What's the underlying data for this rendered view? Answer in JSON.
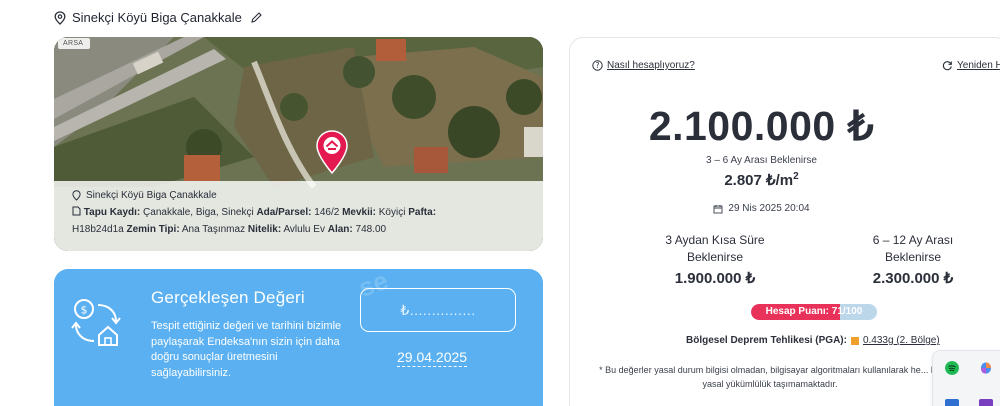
{
  "header": {
    "location": "Sinekçi Köyü Biga Çanakkale"
  },
  "map": {
    "tag": "ARSA",
    "info": {
      "location": "Sinekçi Köyü Biga Çanakkale",
      "tapu_label": "Tapu Kaydı:",
      "tapu_value": "Çanakkale, Biga, Sinekçi",
      "ada_label": "Ada/Parsel:",
      "ada_value": "146/2",
      "mevki_label": "Mevkii:",
      "mevki_value": "Köyiçi",
      "pafta_label": "Pafta:",
      "pafta_value": "H18b24d1a",
      "zemin_label": "Zemin Tipi:",
      "zemin_value": "Ana Taşınmaz",
      "nitelik_label": "Nitelik:",
      "nitelik_value": "Avlulu Ev",
      "alan_label": "Alan:",
      "alan_value": "748.00"
    }
  },
  "realized": {
    "title": "Gerçekleşen Değeri",
    "description": "Tespit ettiğiniz değeri ve tarihini bizimle paylaşarak Endeksa'nın sizin için daha doğru sonuçlar üretmesini sağlayabilirsiniz.",
    "value_placeholder": "₺...............",
    "date": "29.04.2025",
    "watermark": "se"
  },
  "valuation": {
    "how_link": "Nasıl hesaplıyoruz?",
    "refresh_link": "Yeniden H",
    "price": "2.100.000 ₺",
    "condition": "3 – 6 Ay Arası Beklenirse",
    "per_m2": "2.807 ₺/m",
    "per_m2_sup": "2",
    "datetime": "29 Nis 2025 20:04",
    "short_label_1": "3 Aydan Kısa Süre",
    "short_label_2": "Beklenirse",
    "short_value": "1.900.000 ₺",
    "long_label_1": "6 – 12 Ay Arası",
    "long_label_2": "Beklenirse",
    "long_value": "2.300.000 ₺",
    "score_text": "Hesap Puanı: 71/100",
    "score_value": 71,
    "score_max": 100,
    "quake_label": "Bölgesel Deprem Tehlikesi (PGA):",
    "quake_value": "0.433g (2. Bölge)",
    "disclaimer": "* Bu değerler yasal durum bilgisi olmadan, bilgisayar algoritmaları kullanılarak he... bir yasal yükümlülük taşımamaktadır."
  },
  "colors": {
    "accent_blue": "#5ab0f0",
    "score_red": "#e8325a",
    "pin_red": "#e3194f"
  }
}
